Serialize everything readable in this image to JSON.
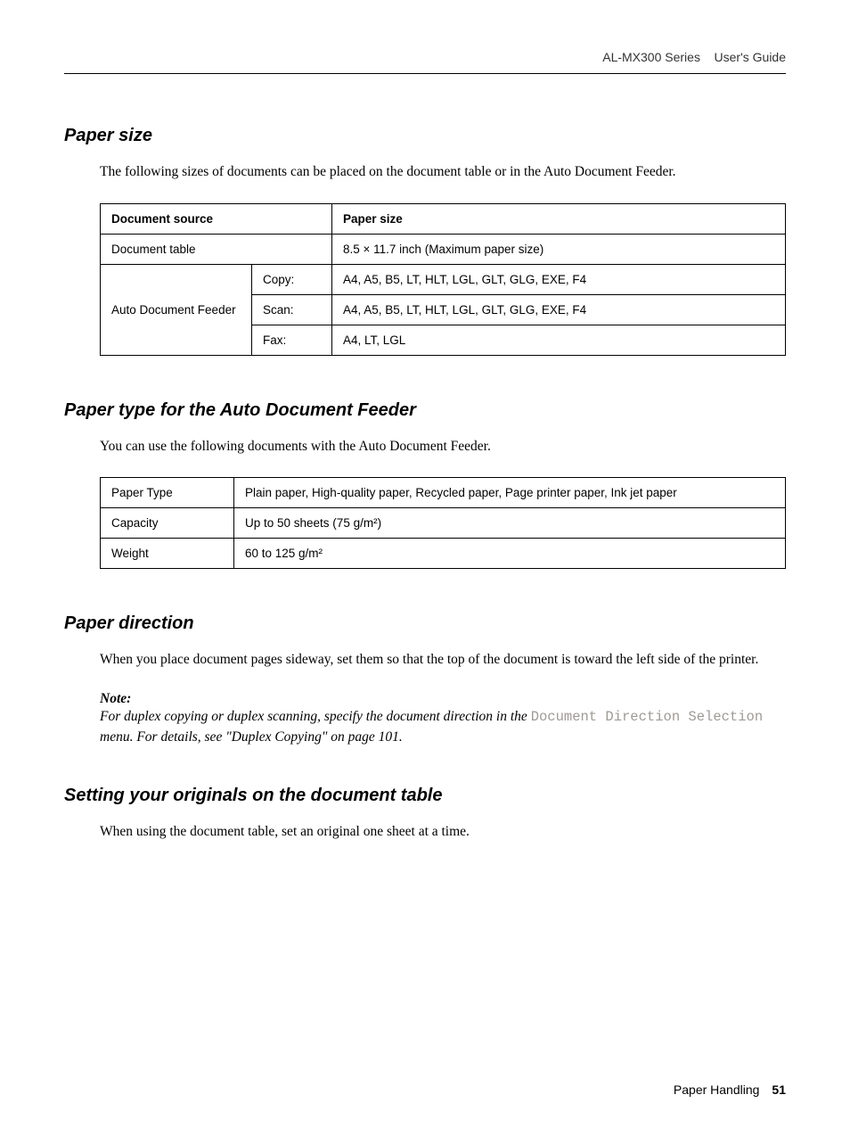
{
  "header": {
    "series": "AL-MX300 Series",
    "doc": "User's Guide"
  },
  "s1": {
    "heading": "Paper size",
    "intro": "The following sizes of documents can be placed on the document table or in the Auto Document Feeder.",
    "th1": "Document source",
    "th2": "Paper size",
    "r1c1": "Document table",
    "r1c2": "8.5 × 11.7 inch (Maximum paper size)",
    "r2c1": "Auto Document Feeder",
    "r2c2": "Copy:",
    "r2c3": "A4, A5, B5, LT, HLT, LGL, GLT, GLG, EXE, F4",
    "r3c2": "Scan:",
    "r3c3": "A4, A5, B5, LT, HLT, LGL, GLT, GLG, EXE, F4",
    "r4c2": "Fax:",
    "r4c3": "A4, LT, LGL"
  },
  "s2": {
    "heading": "Paper type for the Auto Document Feeder",
    "intro": "You can use the following documents with the Auto Document Feeder.",
    "r1c1": "Paper Type",
    "r1c2": "Plain paper, High-quality paper, Recycled paper, Page printer paper, Ink jet paper",
    "r2c1": "Capacity",
    "r2c2": "Up to 50 sheets (75 g/m²)",
    "r3c1": "Weight",
    "r3c2": "60 to 125 g/m²"
  },
  "s3": {
    "heading": "Paper direction",
    "intro": "When you place document pages sideway, set them so that the top of the document is toward the left side of the printer.",
    "note_label": "Note:",
    "note_pre": "For duplex copying or duplex scanning, specify the document direction in the ",
    "note_mono": "Document Direction Selection",
    "note_post": " menu. For details, see \"Duplex Copying\" on page 101."
  },
  "s4": {
    "heading": "Setting your originals on the document table",
    "intro": "When using the document table, set an original one sheet at a time."
  },
  "footer": {
    "section": "Paper Handling",
    "page": "51"
  }
}
